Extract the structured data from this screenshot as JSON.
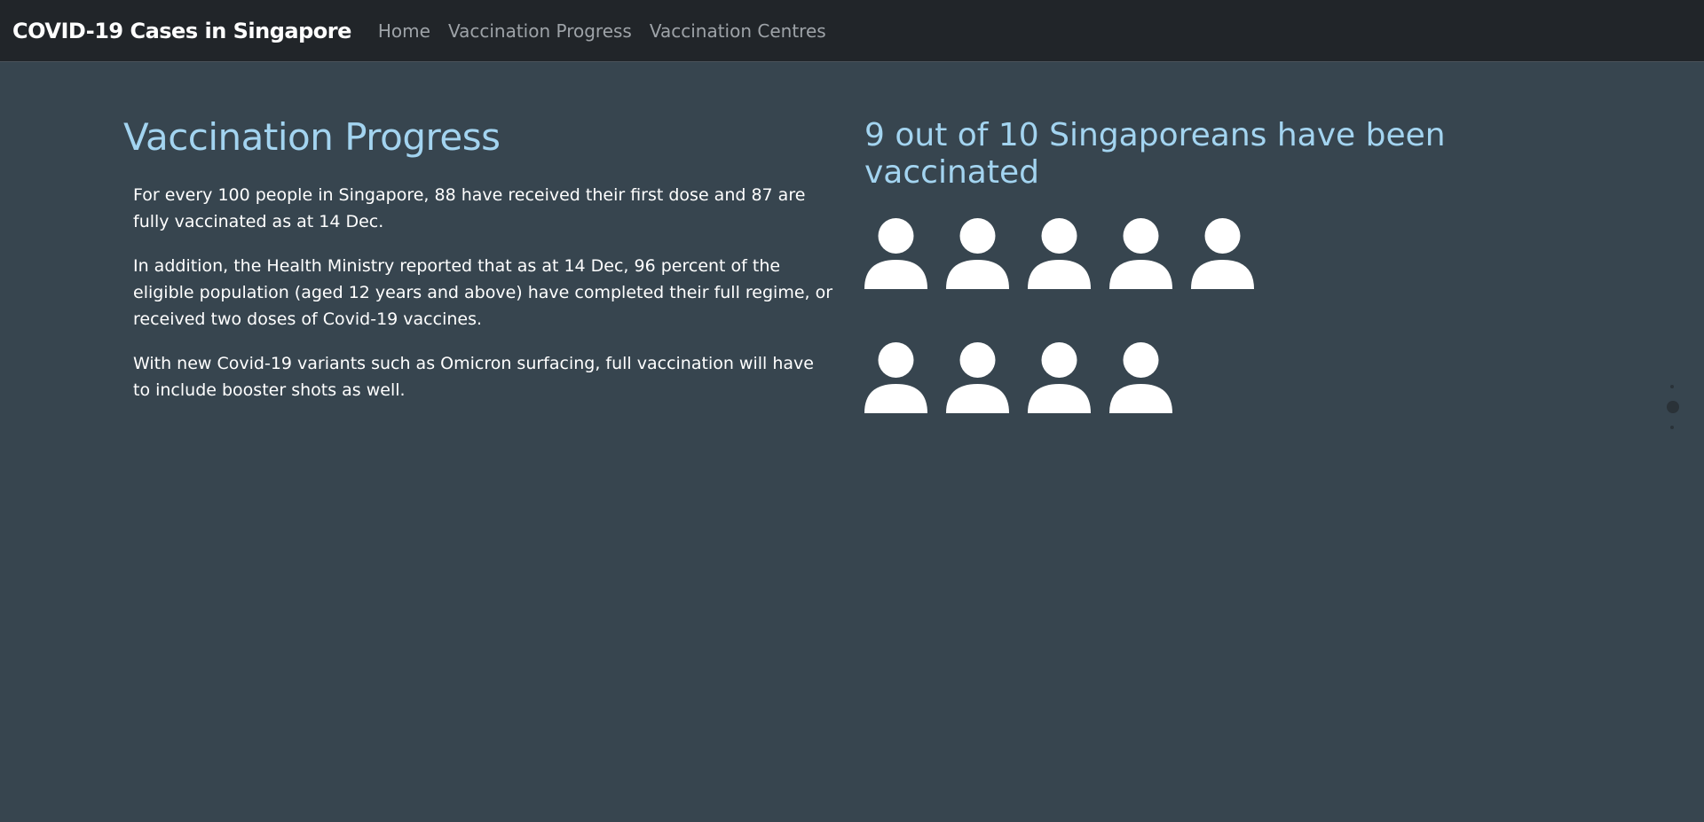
{
  "navbar": {
    "brand": "COVID-19 Cases in Singapore",
    "links": [
      "Home",
      "Vaccination Progress",
      "Vaccination Centres"
    ]
  },
  "main": {
    "title": "Vaccination Progress",
    "paragraphs": [
      "For every 100 people in Singapore, 88 have received their first dose and 87 are fully vaccinated as at 14 Dec.",
      "In addition, the Health Ministry reported that as at 14 Dec, 96 percent of the eligible population (aged 12 years and above) have completed their full regime, or received two doses of Covid-19 vaccines.",
      "With new Covid-19 variants such as Omicron surfacing, full vaccination will have to include booster shots as well."
    ]
  },
  "stat": {
    "title": "9 out of 10 Singaporeans have been vaccinated",
    "icon": "person-icon",
    "icon_count": 9,
    "icon_color": "#ffffff"
  },
  "colors": {
    "navbar_bg": "#212529",
    "page_bg": "#37454f",
    "accent": "#a3d4f0"
  }
}
